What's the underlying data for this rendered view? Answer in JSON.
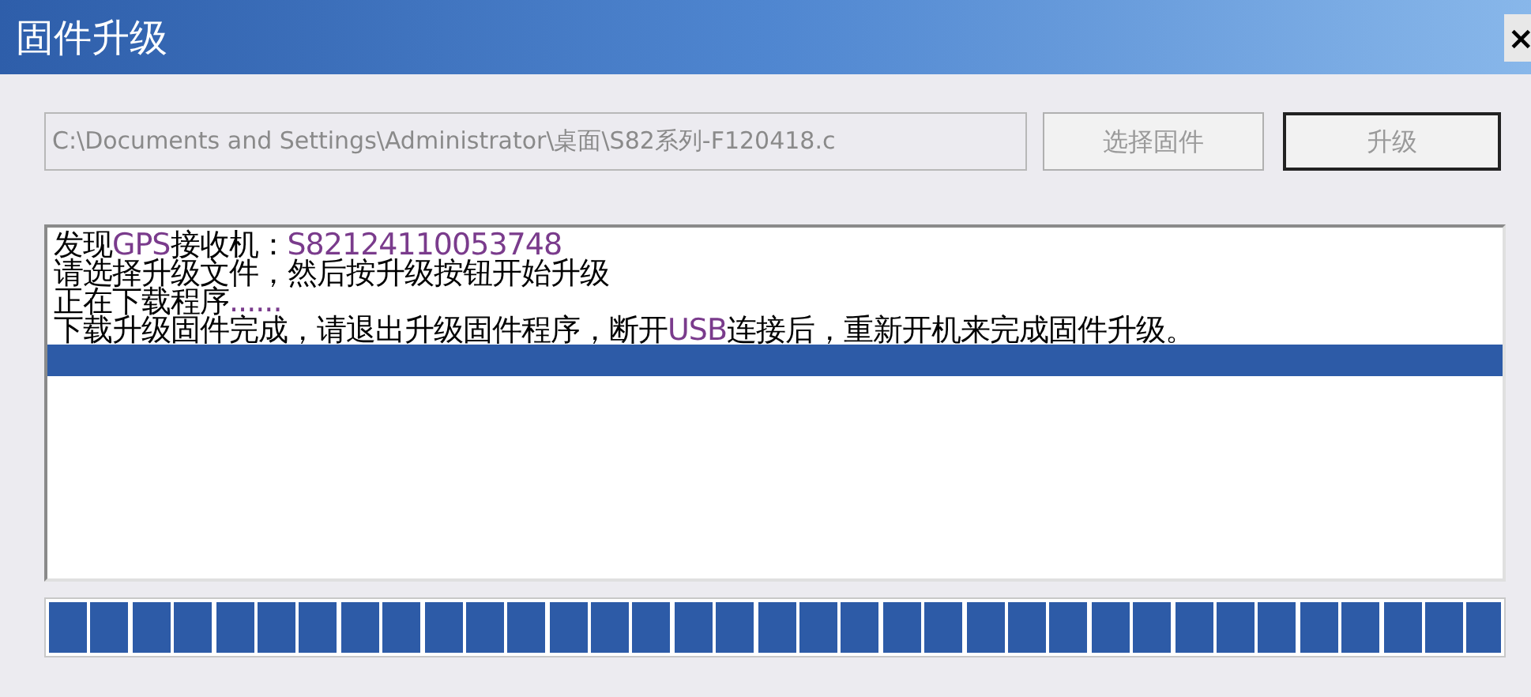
{
  "window": {
    "title": "固件升级",
    "close": "×"
  },
  "file_path": {
    "value": "C:\\Documents and Settings\\Administrator\\桌面\\S82系列-F120418.c",
    "disabled": true
  },
  "buttons": [
    {
      "label": "选择固件",
      "disabled": true,
      "default": false
    },
    {
      "label": "升级",
      "disabled": true,
      "default": true
    }
  ],
  "log": [
    {
      "kind": "text",
      "selected": false,
      "parts": [
        {
          "text": "发现",
          "highlight": false
        },
        {
          "text": "GPS",
          "highlight": true
        },
        {
          "text": "接收机：",
          "highlight": false
        },
        {
          "text": "S82124110053748",
          "highlight": true
        }
      ]
    },
    {
      "kind": "text",
      "selected": false,
      "parts": [
        {
          "text": "请选择升级文件，然后按升级按钮开始升级",
          "highlight": false
        }
      ]
    },
    {
      "kind": "text",
      "selected": false,
      "parts": [
        {
          "text": "正在下载程序",
          "highlight": false
        },
        {
          "text": "......",
          "highlight": true
        }
      ]
    },
    {
      "kind": "text",
      "selected": false,
      "parts": [
        {
          "text": "下载升级固件完成，请退出升级固件程序，断开",
          "highlight": false
        },
        {
          "text": "USB",
          "highlight": true
        },
        {
          "text": "连接后，重新开机来完成固件升级。",
          "highlight": false
        }
      ]
    },
    {
      "kind": "blank",
      "selected": true
    }
  ],
  "progress": {
    "level": 1
  }
}
